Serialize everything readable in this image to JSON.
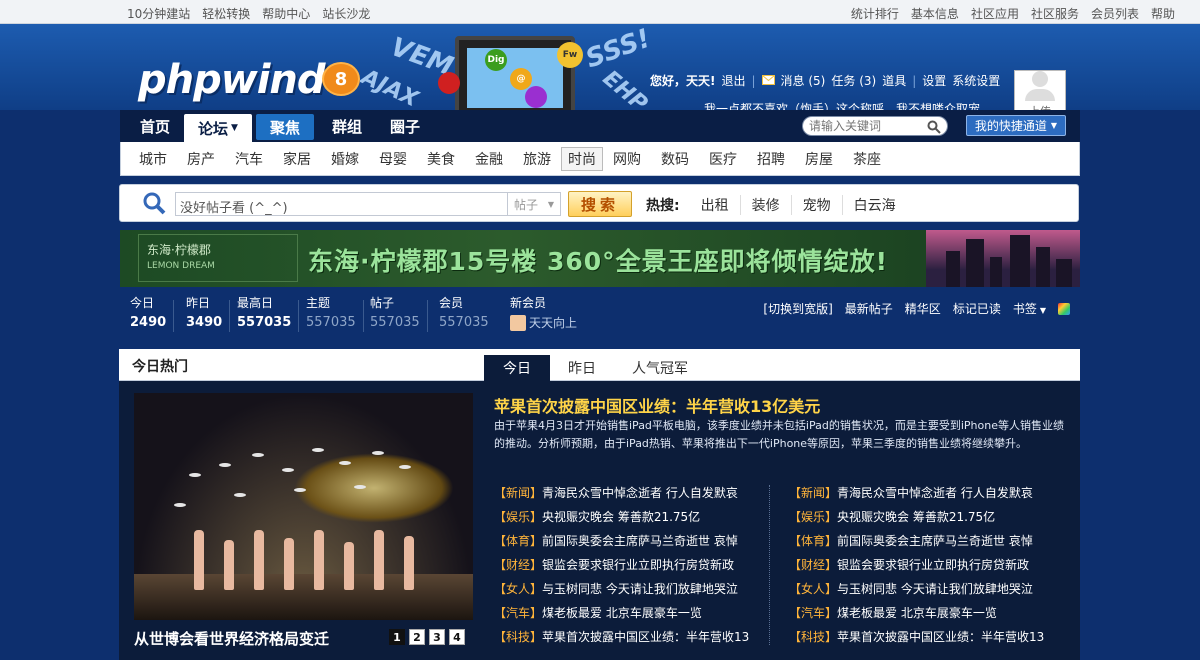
{
  "topbar": {
    "left": [
      "10分钟建站",
      "轻松转换",
      "帮助中心",
      "站长沙龙"
    ],
    "right": [
      "统计排行",
      "基本信息",
      "社区应用",
      "社区服务",
      "会员列表",
      "帮助"
    ]
  },
  "header": {
    "logo": "phpwind",
    "logo_badge": "8",
    "greeting": "您好，天天!",
    "logout": "退出",
    "messages": "消息 (5)",
    "tasks": "任务 (3)",
    "props": "道具",
    "settings": "设置",
    "system_settings": "系统设置",
    "signature": "我一点都不喜欢（炮手）这个称呼，我不想喽众取宠...",
    "upload": "上传",
    "art_words": [
      "VEM",
      "AJAX",
      "SSS!",
      "EHP"
    ],
    "art_balls": [
      "Dig",
      "@",
      "Fw"
    ]
  },
  "nav": {
    "items": [
      "首页",
      "论坛",
      "聚焦",
      "群组",
      "圈子"
    ],
    "search_placeholder": "请输入关键词",
    "quick": "我的快捷通道"
  },
  "subnav": {
    "items": [
      "城市",
      "房产",
      "汽车",
      "家居",
      "婚嫁",
      "母婴",
      "美食",
      "金融",
      "旅游",
      "时尚",
      "网购",
      "数码",
      "医疗",
      "招聘",
      "房屋",
      "茶座"
    ]
  },
  "search": {
    "value": "没好帖子看      (^_^)",
    "type": "帖子",
    "button": "搜索",
    "hot_label": "热搜:",
    "hot": [
      "出租",
      "装修",
      "宠物",
      "白云海"
    ]
  },
  "ad": {
    "brand": "东海·柠檬郡",
    "brand_sub": "LEMON DREAM",
    "slogan": "东海·柠檬郡15号楼 360°全景王座即将倾情绽放!"
  },
  "stats": {
    "today_label": "今日",
    "today": "2490",
    "yesterday_label": "昨日",
    "yesterday": "3490",
    "max_label": "最高日",
    "max": "557035",
    "topics_label": "主题",
    "topics": "557035",
    "posts_label": "帖子",
    "posts": "557035",
    "members_label": "会员",
    "members": "557035",
    "newmem_label": "新会员",
    "newmem": "天天向上",
    "links": [
      "[切换到宽版]",
      "最新帖子",
      "精华区",
      "标记已读",
      "书签"
    ]
  },
  "panel": {
    "title": "今日热门",
    "tabs": [
      "今日",
      "昨日",
      "人气冠军"
    ],
    "caption": "从世博会看世界经济格局变迁",
    "pages": [
      "1",
      "2",
      "3",
      "4"
    ],
    "headline": "苹果首次披露中国区业绩：半年营收13亿美元",
    "summary": "由于苹果4月3日才开始销售iPad平板电脑，该季度业绩并未包括iPad的销售状况，而是主要受到iPhone等人销售业绩的推动。分析师预期，由于iPad热销、苹果将推出下一代iPhone等原因，苹果三季度的销售业绩将继续攀升。",
    "list": [
      {
        "tag": "【新闻】",
        "text": "青海民众雪中悼念逝者 行人自发默哀"
      },
      {
        "tag": "【娱乐】",
        "text": "央视赈灾晚会 筹善款21.75亿"
      },
      {
        "tag": "【体育】",
        "text": "前国际奥委会主席萨马兰奇逝世 哀悼"
      },
      {
        "tag": "【财经】",
        "text": "银监会要求银行业立即执行房贷新政"
      },
      {
        "tag": "【女人】",
        "text": "与玉树同悲 今天请让我们放肆地哭泣"
      },
      {
        "tag": "【汽车】",
        "text": "煤老板最爱 北京车展豪车一览"
      },
      {
        "tag": "【科技】",
        "text": "苹果首次披露中国区业绩：半年营收13"
      }
    ]
  }
}
